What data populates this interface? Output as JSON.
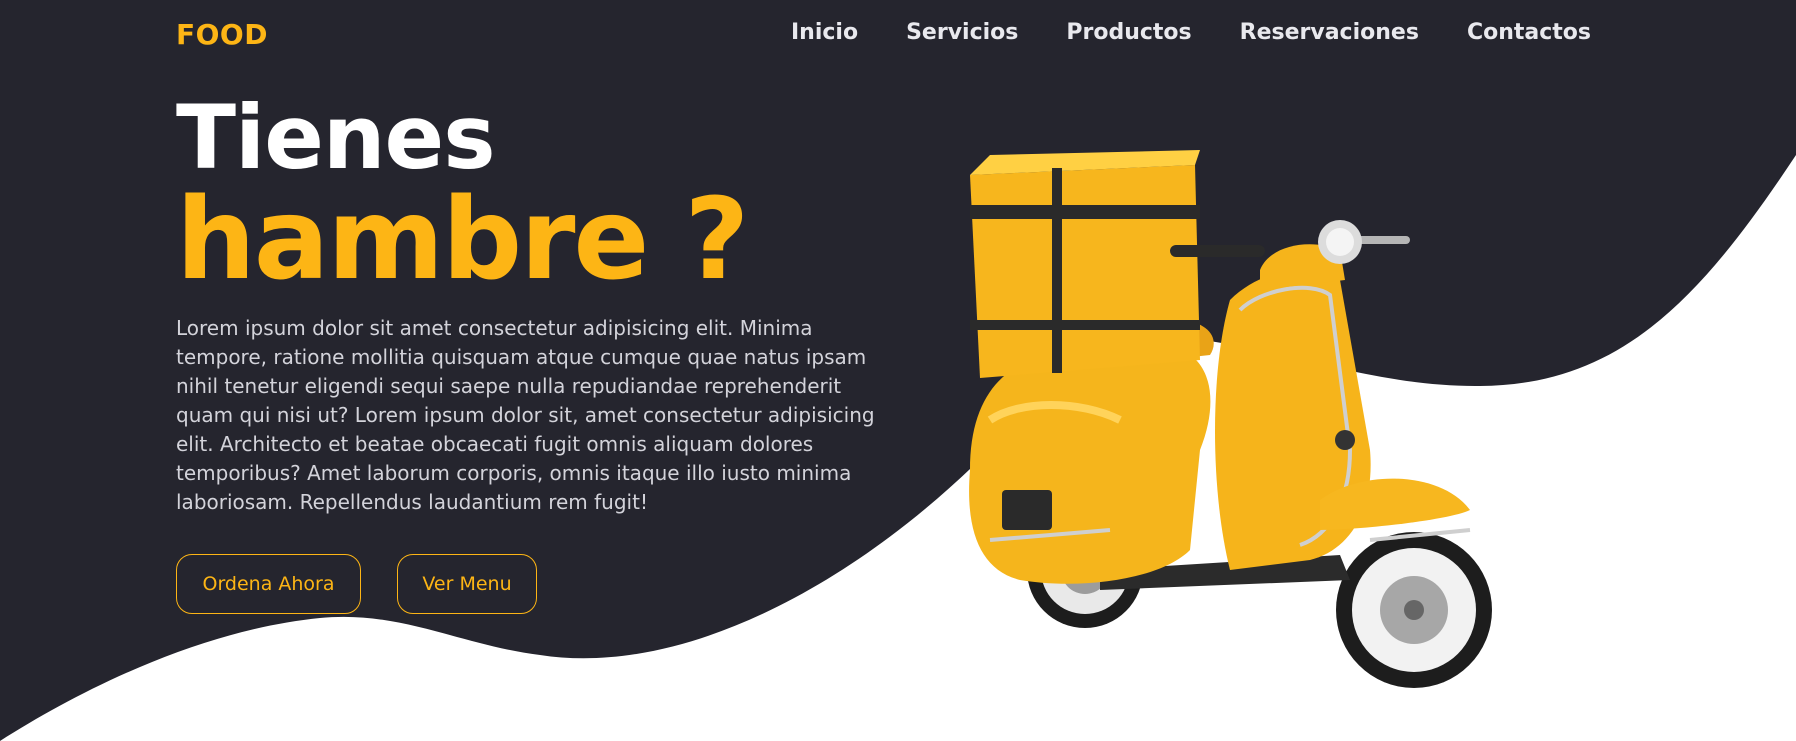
{
  "brand": {
    "logo": "FOOD"
  },
  "nav": {
    "items": [
      {
        "label": "Inicio"
      },
      {
        "label": "Servicios"
      },
      {
        "label": "Productos"
      },
      {
        "label": "Reservaciones"
      },
      {
        "label": "Contactos"
      }
    ]
  },
  "hero": {
    "title_line1": "Tienes",
    "title_line2": "hambre ?",
    "description": "Lorem ipsum dolor sit amet consectetur adipisicing elit. Minima tempore, ratione mollitia quisquam atque cumque quae natus ipsam nihil tenetur eligendi sequi saepe nulla repudiandae reprehenderit quam qui nisi ut? Lorem ipsum dolor sit, amet consectetur adipisicing elit. Architecto et beatae obcaecati fugit omnis aliquam dolores temporibus? Amet laborum corporis, omnis itaque illo iusto minima laboriosam. Repellendus laudantium rem fugit!",
    "buttons": {
      "order": "Ordena Ahora",
      "menu": "Ver Menu"
    }
  },
  "colors": {
    "accent": "#fdb515",
    "dark_bg": "#25252e",
    "light_bg": "#ffffff",
    "nav_text": "#e9e9ee",
    "body_text": "#d3d3da"
  },
  "icons": {
    "hero_image": "delivery-scooter-icon"
  }
}
